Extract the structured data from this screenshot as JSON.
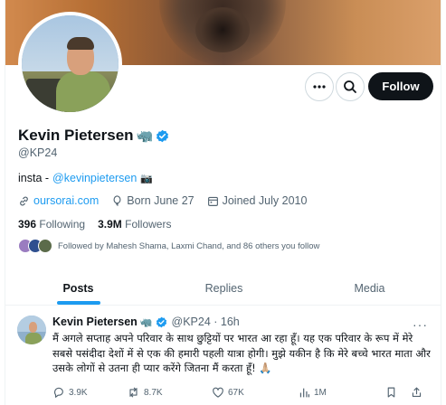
{
  "profile": {
    "name": "Kevin Pietersen",
    "name_emoji": "🦏",
    "handle": "@KP24",
    "bio_prefix": "insta - ",
    "bio_link": "@kevinpietersen",
    "bio_emoji": "📷",
    "website": "oursorai.com",
    "born": "Born June 27",
    "joined": "Joined July 2010",
    "following_count": "396",
    "following_label": "Following",
    "followers_count": "3.9M",
    "followers_label": "Followers",
    "followed_by": "Followed by Mahesh Shama, Laxmi Chand, and 86 others you follow"
  },
  "actions": {
    "follow_label": "Follow",
    "more_icon": "more-icon",
    "search_icon": "search-icon"
  },
  "tabs": [
    {
      "label": "Posts",
      "active": true
    },
    {
      "label": "Replies",
      "active": false
    },
    {
      "label": "Media",
      "active": false
    }
  ],
  "tweet": {
    "author": "Kevin Pietersen",
    "author_emoji": "🦏",
    "handle_time": "@KP24 · 16h",
    "text": "मैं अगले सप्ताह अपने परिवार के साथ छुट्टियों पर भारत आ रहा हूँ। यह एक परिवार के रूप में मेरे सबसे पसंदीदा देशों में से एक की हमारी पहली यात्रा होगी। मुझे यकीन है कि मेरे बच्चे भारत माता और उसके लोगों से उतना ही प्यार करेंगे जितना मैं करता हूँ! 🙏🏼",
    "replies": "3.9K",
    "reposts": "8.7K",
    "likes": "67K",
    "views": "1M"
  },
  "colors": {
    "accent": "#1d9bf0",
    "text": "#0f1419",
    "muted": "#536471",
    "follow_bg": "#0f1419"
  }
}
